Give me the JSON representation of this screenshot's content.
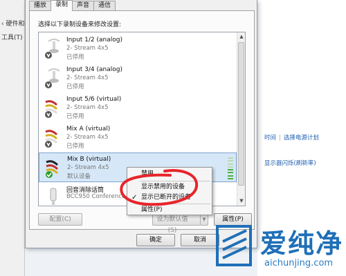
{
  "background": {
    "breadcrumb": "‹ 硬件和",
    "menu_label": "工具(T)",
    "link_time": "时间",
    "link_power_plan": "选择电源计划",
    "link_display": "显示器闪烁(刷新率)"
  },
  "dialog": {
    "tabs": [
      {
        "label": "播放"
      },
      {
        "label": "录制"
      },
      {
        "label": "声音"
      },
      {
        "label": "通信"
      }
    ],
    "instruction": "选择以下录制设备来修改设置:",
    "devices": [
      {
        "name": "Input 1/2 (analog)",
        "sub": "2- Stream 4x5",
        "status": "已停用",
        "icon": "microphone-disabled-icon"
      },
      {
        "name": "Input 3/4 (analog)",
        "sub": "2- Stream 4x5",
        "status": "已停用",
        "icon": "microphone-disabled-icon"
      },
      {
        "name": "Input 5/6 (virtual)",
        "sub": "2- Stream 4x5",
        "status": "已停用",
        "icon": "rca-cable-disabled-icon"
      },
      {
        "name": "Mix A (virtual)",
        "sub": "2- Stream 4x5",
        "status": "已停用",
        "icon": "rca-cable-disabled-icon"
      },
      {
        "name": "Mix B (virtual)",
        "sub": "2- Stream 4x5",
        "status": "默认设备",
        "icon": "rca-cable-default-icon"
      },
      {
        "name": "回音消除话筒",
        "sub": "BCC950 Conference",
        "status": "",
        "icon": "microphone-icon"
      }
    ],
    "buttons": {
      "configure": "配置(C)",
      "set_default": "设为默认值(S)",
      "properties": "属性(P)",
      "ok": "确定",
      "cancel": "取消"
    }
  },
  "context_menu": {
    "items": [
      {
        "label": "禁用",
        "checked": false
      },
      {
        "label": "显示禁用的设备",
        "checked": false
      },
      {
        "label": "显示已断开的设备",
        "checked": true
      },
      {
        "label": "属性(P)",
        "checked": false
      }
    ]
  },
  "watermark": {
    "chinese": "爱纯净",
    "url": "aichunjing.com"
  },
  "colors": {
    "accent_green": "#4caf3d",
    "selection": "#d6e8f8",
    "annotation_red": "#e8242b",
    "watermark_blue": "#1f6fb8"
  }
}
